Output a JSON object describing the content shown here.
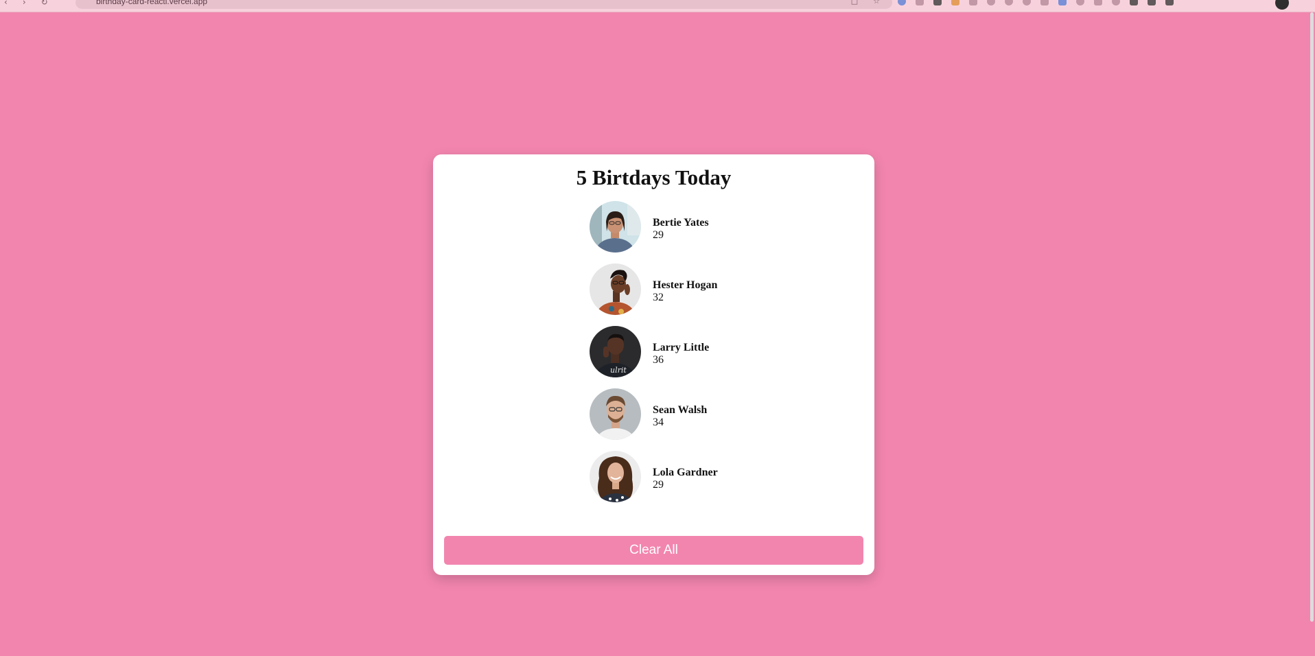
{
  "browser": {
    "url": "birthday-card-reacti.vercel.app"
  },
  "card": {
    "title": "5 Birtdays Today",
    "clear_label": "Clear All"
  },
  "people": [
    {
      "name": "Bertie Yates",
      "age": "29",
      "avatar": "person-photo"
    },
    {
      "name": "Hester Hogan",
      "age": "32",
      "avatar": "person-photo"
    },
    {
      "name": "Larry Little",
      "age": "36",
      "avatar": "person-photo"
    },
    {
      "name": "Sean Walsh",
      "age": "34",
      "avatar": "person-photo"
    },
    {
      "name": "Lola Gardner",
      "age": "29",
      "avatar": "person-photo"
    }
  ],
  "colors": {
    "background": "#f285ae",
    "card": "#ffffff",
    "button": "#f285ae",
    "button_text": "#ffffff"
  }
}
